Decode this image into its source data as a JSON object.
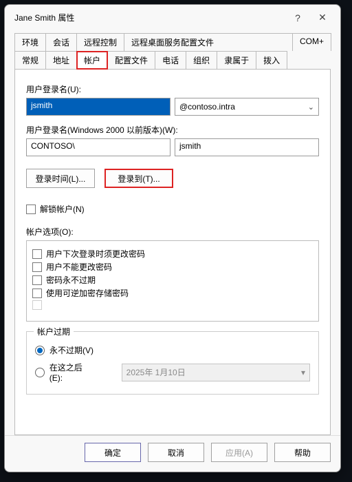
{
  "window": {
    "title": "Jane Smith 属性"
  },
  "tabs_row1": [
    {
      "label": "环境"
    },
    {
      "label": "会话"
    },
    {
      "label": "远程控制"
    },
    {
      "label": "远程桌面服务配置文件"
    },
    {
      "label": "COM+"
    }
  ],
  "tabs_row2": [
    {
      "label": "常规"
    },
    {
      "label": "地址"
    },
    {
      "label": "帐户",
      "active": true
    },
    {
      "label": "配置文件"
    },
    {
      "label": "电话"
    },
    {
      "label": "组织"
    },
    {
      "label": "隶属于"
    },
    {
      "label": "拨入"
    }
  ],
  "logon": {
    "label": "用户登录名(U):",
    "value": "jsmith",
    "suffix_selected": "@contoso.intra"
  },
  "pre2k": {
    "label": "用户登录名(Windows 2000 以前版本)(W):",
    "domain": "CONTOSO\\",
    "value": "jsmith"
  },
  "buttons": {
    "logon_hours": "登录时间(L)...",
    "logon_to": "登录到(T)..."
  },
  "unlock": {
    "label": "解锁帐户(N)"
  },
  "options": {
    "legend": "帐户选项(O):",
    "items": [
      "用户下次登录时须更改密码",
      "用户不能更改密码",
      "密码永不过期",
      "使用可逆加密存储密码"
    ]
  },
  "expiry": {
    "legend": "帐户过期",
    "never_label": "永不过期(V)",
    "after_label": "在这之后(E):",
    "date": "2025年  1月10日",
    "selected": "never"
  },
  "footer": {
    "ok": "确定",
    "cancel": "取消",
    "apply": "应用(A)",
    "help": "帮助"
  }
}
